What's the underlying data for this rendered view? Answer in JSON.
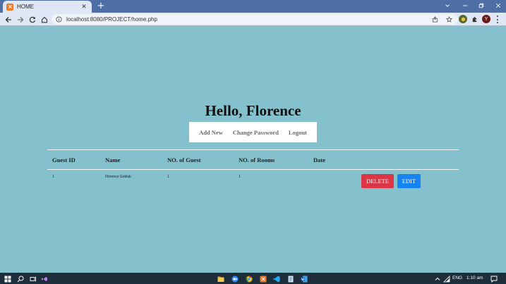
{
  "browser": {
    "tab_title": "HOME",
    "url": "localhost:8080/PROJECT/home.php"
  },
  "page": {
    "greeting": "Hello, Florence",
    "menu": {
      "add_new": "Add New",
      "change_password": "Change Password",
      "logout": "Logout"
    },
    "table": {
      "headers": [
        "Guest ID",
        "Name",
        "NO. of Guest",
        "NO. of Rooms",
        "Date"
      ],
      "rows": [
        {
          "guest_id": "1",
          "name": "Florence Goblab",
          "guests": "1",
          "rooms": "1",
          "date": "",
          "delete_label": "DELETE",
          "edit_label": "EDIT"
        }
      ]
    }
  },
  "taskbar": {
    "language": "ENG",
    "time": "1:10 am"
  },
  "colors": {
    "page_background": "#85c1cc",
    "delete_button": "#dc3545",
    "edit_button": "#1583f4",
    "tab_strip": "#4d6fa6",
    "taskbar": "#1e2d3a"
  }
}
